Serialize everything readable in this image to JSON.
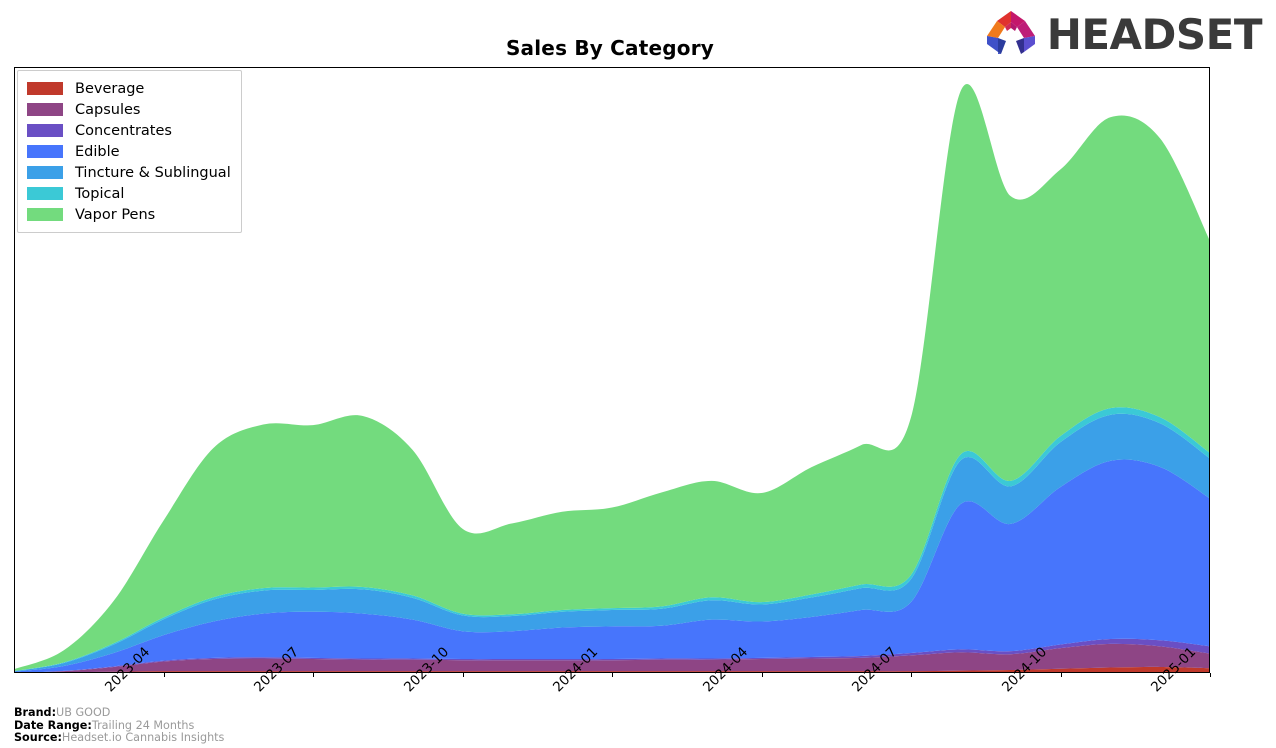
{
  "header": {
    "title": "Sales By Category",
    "logo_text": "HEADSET",
    "logo_icon": "headset-logo-icon"
  },
  "footnotes": [
    {
      "key": "Brand:",
      "value": "UB GOOD"
    },
    {
      "key": "Date Range:",
      "value": "Trailing 24 Months"
    },
    {
      "key": "Source:",
      "value": "Headset.io Cannabis Insights"
    }
  ],
  "legend": {
    "position": "upper-left",
    "items": [
      {
        "label": "Beverage",
        "color": "#C0392B"
      },
      {
        "label": "Capsules",
        "color": "#8E4585"
      },
      {
        "label": "Concentrates",
        "color": "#6A4FC4"
      },
      {
        "label": "Edible",
        "color": "#4775FC"
      },
      {
        "label": "Tincture & Sublingual",
        "color": "#3BA0E8"
      },
      {
        "label": "Topical",
        "color": "#3BC9D6"
      },
      {
        "label": "Vapor Pens",
        "color": "#73DB7E"
      }
    ]
  },
  "chart_data": {
    "type": "area",
    "stacked": true,
    "title": "Sales By Category",
    "xlabel": "",
    "ylabel": "",
    "grid": false,
    "legend_position": "upper-left",
    "x": [
      "2023-01",
      "2023-02",
      "2023-03",
      "2023-04",
      "2023-05",
      "2023-06",
      "2023-07",
      "2023-08",
      "2023-09",
      "2023-10",
      "2023-11",
      "2023-12",
      "2024-01",
      "2024-02",
      "2024-03",
      "2024-04",
      "2024-05",
      "2024-06",
      "2024-07",
      "2024-08",
      "2024-09",
      "2024-10",
      "2024-11",
      "2024-12",
      "2025-01"
    ],
    "xtick_labels": [
      "2023-04",
      "2023-07",
      "2023-10",
      "2024-01",
      "2024-04",
      "2024-07",
      "2024-10",
      "2025-01"
    ],
    "xtick_positions": [
      3,
      6,
      9,
      12,
      15,
      18,
      21,
      24
    ],
    "ylim": [
      0,
      100
    ],
    "series": [
      {
        "name": "Beverage",
        "color": "#C0392B",
        "values": [
          0.0,
          0.1,
          0.2,
          0.3,
          0.3,
          0.3,
          0.3,
          0.3,
          0.3,
          0.3,
          0.3,
          0.3,
          0.3,
          0.3,
          0.3,
          0.3,
          0.3,
          0.3,
          0.3,
          0.4,
          0.5,
          0.7,
          0.9,
          1.0,
          0.8
        ]
      },
      {
        "name": "Capsules",
        "color": "#8E4585",
        "values": [
          0.0,
          0.2,
          0.8,
          1.6,
          2.0,
          2.1,
          2.0,
          1.9,
          1.9,
          1.8,
          1.8,
          1.8,
          1.8,
          1.9,
          1.9,
          2.0,
          2.1,
          2.2,
          2.6,
          3.0,
          2.6,
          3.4,
          3.9,
          3.4,
          2.4
        ]
      },
      {
        "name": "Concentrates",
        "color": "#6A4FC4",
        "values": [
          0.0,
          0.05,
          0.1,
          0.15,
          0.2,
          0.2,
          0.2,
          0.2,
          0.2,
          0.2,
          0.2,
          0.2,
          0.2,
          0.2,
          0.2,
          0.2,
          0.25,
          0.3,
          0.4,
          0.5,
          0.5,
          0.6,
          0.8,
          1.0,
          1.2
        ]
      },
      {
        "name": "Edible",
        "color": "#4775FC",
        "values": [
          0.2,
          0.8,
          2.2,
          4.2,
          6.0,
          7.2,
          7.6,
          7.4,
          6.4,
          4.6,
          4.6,
          5.2,
          5.4,
          5.4,
          6.4,
          6.0,
          6.6,
          7.6,
          8.4,
          24.0,
          21.0,
          26.0,
          29.4,
          28.6,
          24.4
        ]
      },
      {
        "name": "Tincture & Sublingual",
        "color": "#3BA0E8",
        "values": [
          0.1,
          0.5,
          1.4,
          2.6,
          3.6,
          3.8,
          3.6,
          4.0,
          3.6,
          2.6,
          2.5,
          2.6,
          2.7,
          2.8,
          3.2,
          2.8,
          3.2,
          3.6,
          3.8,
          7.2,
          6.2,
          7.4,
          7.6,
          7.2,
          6.6
        ]
      },
      {
        "name": "Topical",
        "color": "#3BC9D6",
        "values": [
          0.02,
          0.1,
          0.2,
          0.3,
          0.4,
          0.4,
          0.4,
          0.4,
          0.4,
          0.3,
          0.3,
          0.3,
          0.3,
          0.4,
          0.5,
          0.4,
          0.5,
          0.6,
          0.7,
          1.0,
          0.9,
          1.0,
          1.1,
          1.0,
          0.9
        ]
      },
      {
        "name": "Vapor Pens",
        "color": "#73DB7E",
        "values": [
          0.3,
          2.0,
          7.0,
          16.0,
          24.6,
          27.0,
          26.8,
          28.2,
          24.0,
          14.0,
          15.0,
          16.2,
          16.6,
          18.8,
          19.2,
          18.0,
          21.0,
          23.0,
          26.0,
          60.0,
          47.0,
          44.0,
          48.0,
          46.0,
          35.0
        ]
      }
    ]
  }
}
